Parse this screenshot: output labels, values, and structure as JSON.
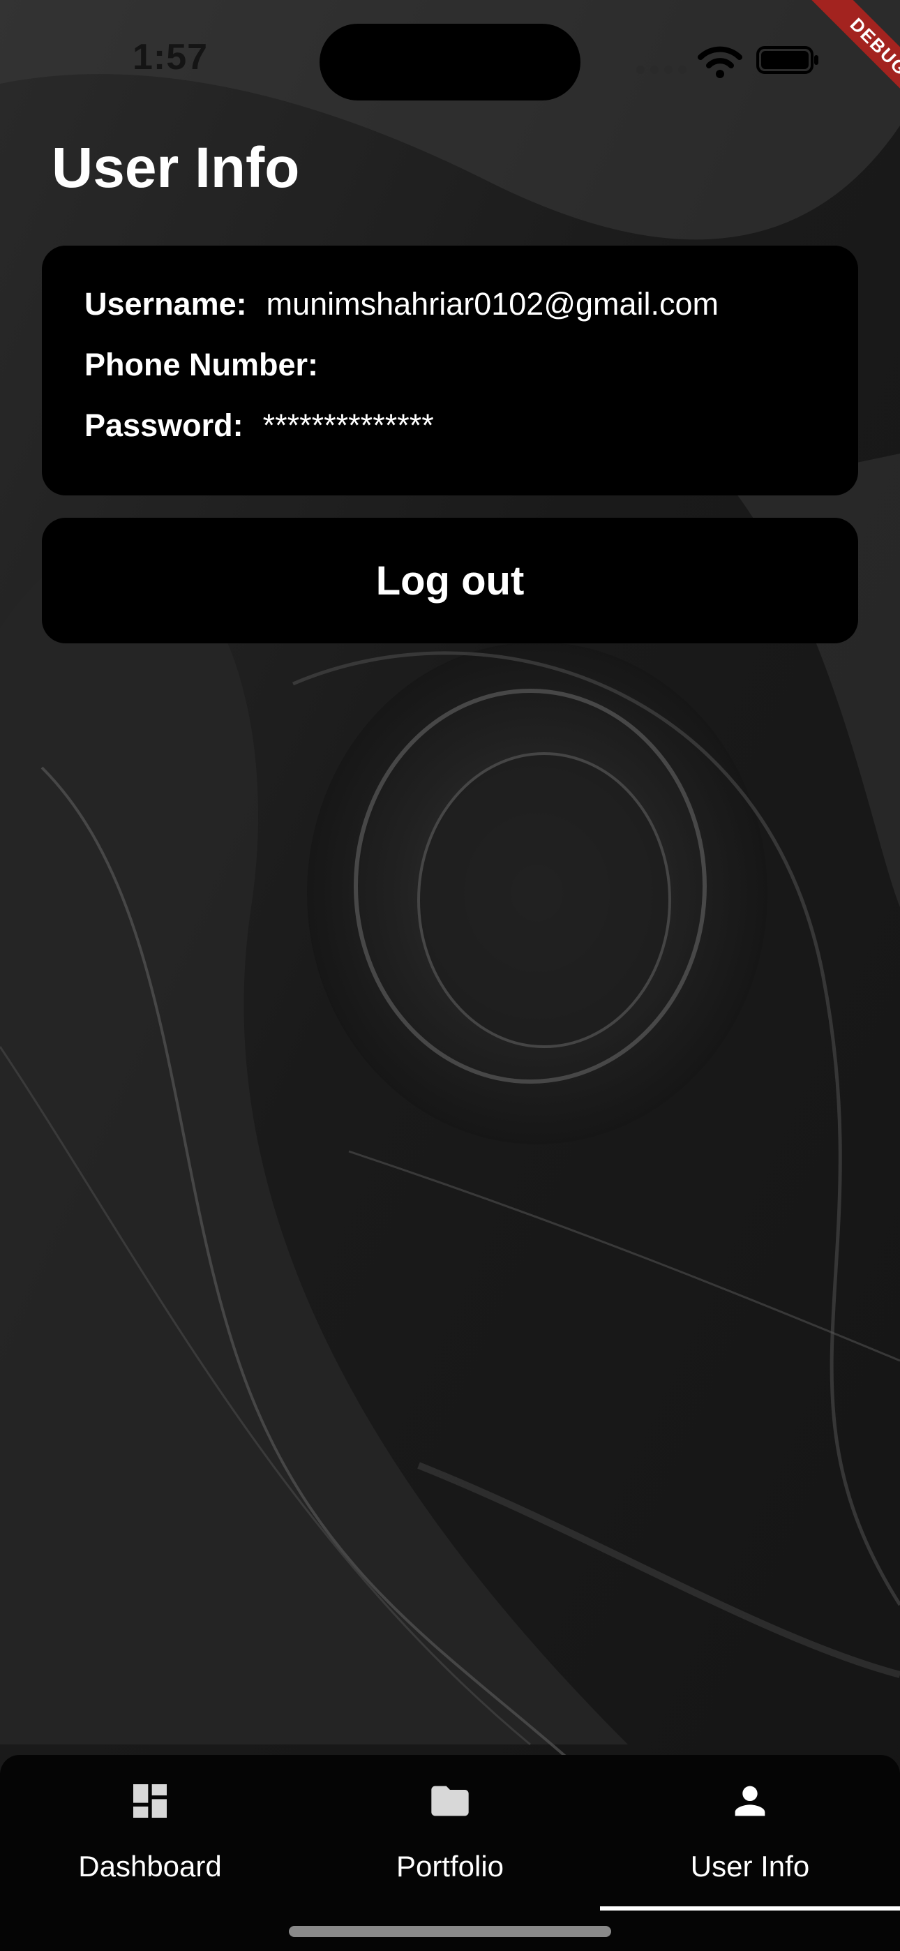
{
  "status_bar": {
    "time": "1:57",
    "icons": [
      "signal-icon",
      "wifi-icon",
      "battery-icon"
    ]
  },
  "debug_banner": {
    "label": "DEBUG",
    "color": "#a3231f"
  },
  "page": {
    "title": "User Info"
  },
  "user_info": {
    "username_label": "Username:",
    "username_value": "munimshahriar0102@gmail.com",
    "phone_label": "Phone Number:",
    "phone_value": "",
    "password_label": "Password:",
    "password_value": "**************"
  },
  "logout_button": {
    "label": "Log out"
  },
  "bottom_nav": {
    "items": [
      {
        "label": "Dashboard",
        "icon": "dashboard-icon",
        "selected": false
      },
      {
        "label": "Portfolio",
        "icon": "folder-icon",
        "selected": false
      },
      {
        "label": "User Info",
        "icon": "person-icon",
        "selected": true
      }
    ]
  },
  "colors": {
    "card_background": "#000000",
    "text": "#ffffff",
    "nav_background": "#050505",
    "icon_inactive": "#d8d8d8"
  }
}
